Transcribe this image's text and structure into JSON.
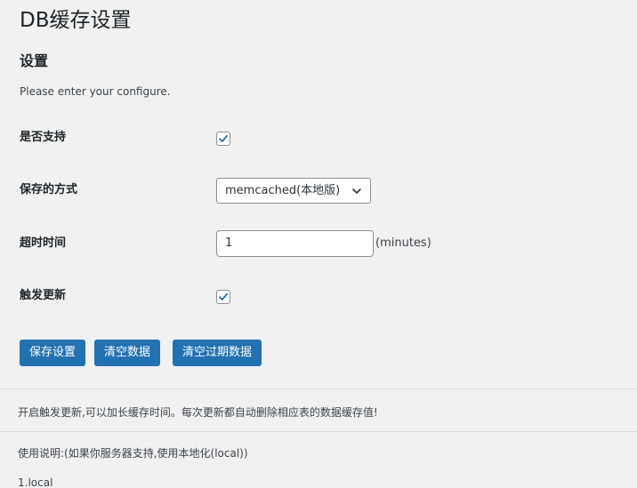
{
  "header": {
    "page_title": "DB缓存设置",
    "section_title": "设置",
    "intro": "Please enter your configure."
  },
  "form": {
    "enable": {
      "label": "是否支持",
      "checked": true
    },
    "storage_method": {
      "label": "保存的方式",
      "selected": "memcached(本地版)"
    },
    "timeout": {
      "label": "超时时间",
      "value": "1",
      "unit": "(minutes)"
    },
    "trigger_update": {
      "label": "触发更新",
      "checked": true
    }
  },
  "buttons": {
    "save": "保存设置",
    "clear": "清空数据",
    "clear_expired": "清空过期数据"
  },
  "notes": {
    "tip": "开启触发更新,可以加长缓存时间。每次更新都自动删除相应表的数据缓存值!",
    "usage": "使用说明:(如果你服务器支持,使用本地化(local))",
    "item1": "1.local"
  },
  "colors": {
    "primary": "#2271b1",
    "background": "#f1f1f1",
    "text": "#1d2327"
  },
  "icons": {
    "checkbox_check": "checkmark-icon",
    "select_arrow": "chevron-down-icon"
  }
}
